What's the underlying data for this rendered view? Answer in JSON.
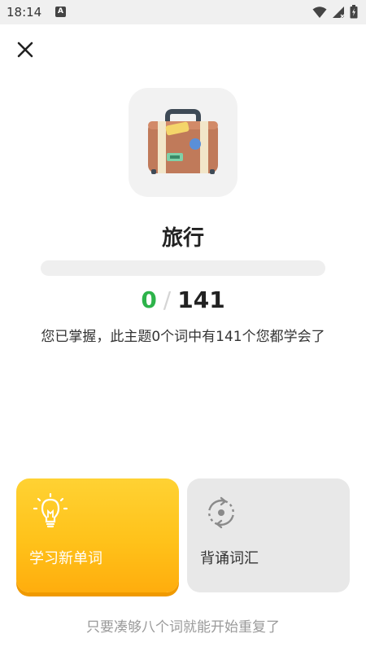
{
  "status_bar": {
    "time": "18:14",
    "notification_letter": "A",
    "icons": [
      "wifi-icon",
      "cell-signal-icon",
      "battery-icon"
    ]
  },
  "topic": {
    "title": "旅行",
    "icon": "suitcase-icon",
    "progress": {
      "mastered": 0,
      "total": 141,
      "fraction": 0
    },
    "mastered_count": "0",
    "separator": "/",
    "total_count": "141",
    "description": "您已掌握，此主题0个词中有141个您都学会了"
  },
  "actions": {
    "close_icon": "close-icon",
    "learn_new_label": "学习新单词",
    "learn_new_icon": "lightbulb-icon",
    "review_label": "背诵词汇",
    "review_icon": "refresh-cycle-icon"
  },
  "footer": {
    "hint": "只要凑够八个词就能开始重复了"
  },
  "colors": {
    "accent_green": "#2db34a",
    "learn_card_yellow": "#ffc21a",
    "review_card_gray": "#e8e8e8"
  }
}
